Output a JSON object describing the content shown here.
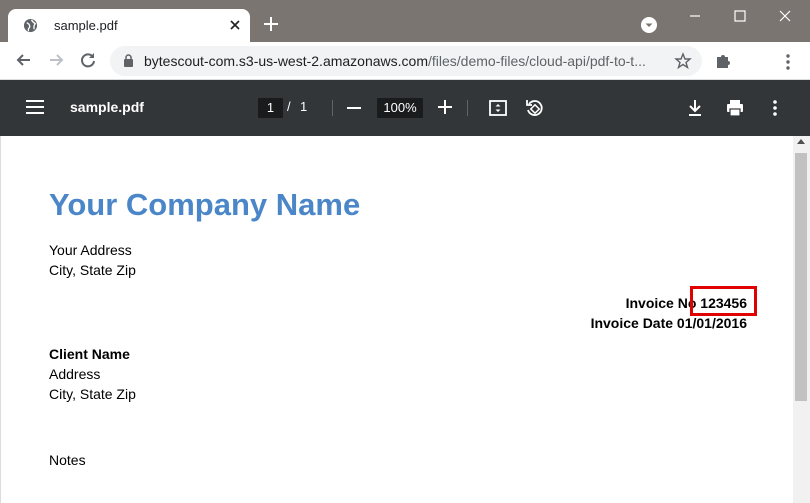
{
  "browser": {
    "tab_title": "sample.pdf",
    "url_host": "bytescout-com.s3-us-west-2.amazonaws.com",
    "url_path": "/files/demo-files/cloud-api/pdf-to-t..."
  },
  "viewer": {
    "file_name": "sample.pdf",
    "page_current": "1",
    "page_separator": "/",
    "page_total": "1",
    "zoom": "100%"
  },
  "document": {
    "company_name": "Your Company Name",
    "address_line1": "Your Address",
    "address_line2": "City, State Zip",
    "invoice_no_label": "Invoice No",
    "invoice_no_value": "123456",
    "invoice_date": "Invoice Date 01/01/2016",
    "client_name": "Client Name",
    "client_address1": "Address",
    "client_address2": "City, State Zip",
    "notes_label": "Notes"
  },
  "colors": {
    "accent": "#4a86c8",
    "highlight": "#e00000",
    "viewer_bar": "#323639"
  }
}
